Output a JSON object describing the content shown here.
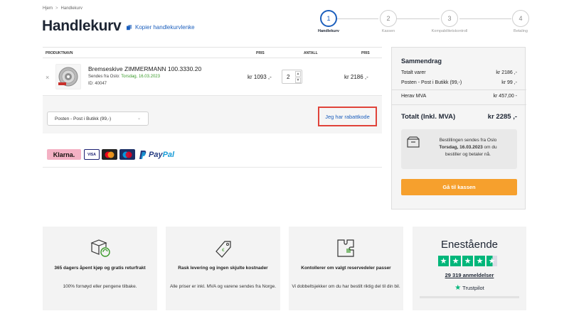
{
  "breadcrumb": {
    "home": "Hjem",
    "separator": ">",
    "current": "Handlekurv"
  },
  "page": {
    "title": "Handlekurv",
    "copy_link": "Kopier handlekurvlenke"
  },
  "steps": [
    {
      "num": "1",
      "label": "Handlekurv"
    },
    {
      "num": "2",
      "label": "Kassen"
    },
    {
      "num": "3",
      "label": "Kompabilitetskontroll"
    },
    {
      "num": "4",
      "label": "Betaling"
    }
  ],
  "cart": {
    "headers": {
      "product": "PRODUKTNAVN",
      "price": "PRIS",
      "qty": "ANTALL",
      "total": "PRIS"
    },
    "item": {
      "remove": "×",
      "name": "Bremseskive ZIMMERMANN 100.3330.20",
      "ship_prefix": "Sendes fra Oslo:",
      "ship_date": "Torsdag, 16.03.2023",
      "id": "ID: 40047",
      "unit_price": "kr 1093 ,-",
      "quantity": "2",
      "line_price": "kr 2186 ,-"
    },
    "shipping_option": "Posten - Post i Butikk (99,-)",
    "coupon_link": "Jeg har rabattkode"
  },
  "payment": {
    "klarna": "Klarna.",
    "visa": "VISA",
    "paypal_pay": "Pay",
    "paypal_pal": "Pal"
  },
  "summary": {
    "title": "Sammendrag",
    "rows": [
      {
        "label": "Totalt varer",
        "value": "kr 2186 ,-"
      },
      {
        "label": "Posten - Post i Butikk (99,-)",
        "value": "kr 99 ,-"
      },
      {
        "label": "Herav MVA",
        "value": "kr 457,00 -"
      }
    ],
    "total_label": "Totalt (Inkl. MVA)",
    "total_value": "kr 2285 ,-",
    "ship_info_1": "Bestillingen sendes fra Oslo",
    "ship_info_date": "Torsdag, 16.03.2023",
    "ship_info_2": "om du",
    "ship_info_3": "bestiller og betaler nå.",
    "checkout": "Gå til kassen"
  },
  "features": [
    {
      "title": "365 dagers åpent kjøp og gratis returfrakt",
      "text": "100% fornøyd eller pengene tilbake."
    },
    {
      "title": "Rask levering og ingen skjulte kostnader",
      "text": "Alle priser er inkl. MVA og varene sendes fra Norge."
    },
    {
      "title": "Kontollerer om valgt reservedeler passer",
      "text": "Vi dobbeltsjekker om du har bestilt riktig del til din bil."
    }
  ],
  "trustpilot": {
    "headline": "Enestående",
    "reviews": "29 319 anmeldelser",
    "brand": "Trustpilot",
    "rating_stars": 4.5
  },
  "colors": {
    "accent_blue": "#1c5fbd",
    "checkout_orange": "#f6a02d",
    "highlight_red": "#e0433a",
    "trust_green": "#00b67a",
    "ship_green": "#3a9a2a"
  }
}
